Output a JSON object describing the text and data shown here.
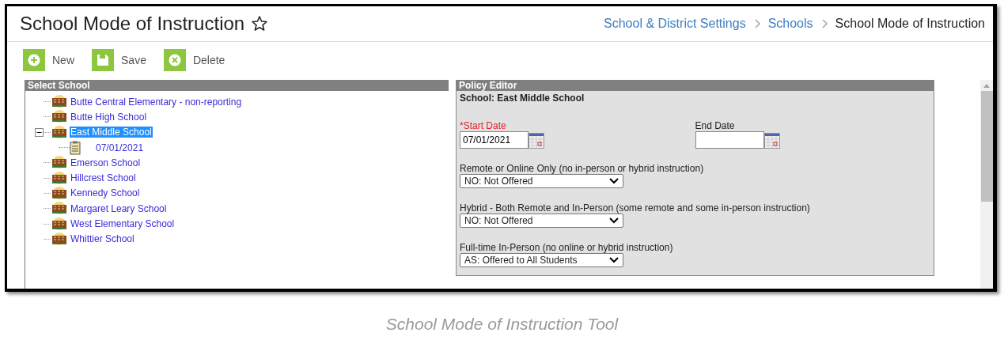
{
  "header": {
    "title": "School Mode of Instruction",
    "favorited": false
  },
  "breadcrumbs": [
    {
      "label": "School & District Settings",
      "link": true
    },
    {
      "label": "Schools",
      "link": true
    },
    {
      "label": "School Mode of Instruction",
      "link": false
    }
  ],
  "toolbar": [
    {
      "label": "New",
      "kind": "new"
    },
    {
      "label": "Save",
      "kind": "save"
    },
    {
      "label": "Delete",
      "kind": "delete"
    }
  ],
  "tree": {
    "title": "Select School",
    "items": [
      {
        "label": "Butte Central Elementary - non-reporting",
        "selected": false,
        "expanded": false
      },
      {
        "label": "Butte High School",
        "selected": false,
        "expanded": false
      },
      {
        "label": "East Middle School",
        "selected": true,
        "expanded": true,
        "children": [
          {
            "label": "07/01/2021",
            "selected": false
          }
        ]
      },
      {
        "label": "Emerson School",
        "selected": false,
        "expanded": false
      },
      {
        "label": "Hillcrest School",
        "selected": false,
        "expanded": false
      },
      {
        "label": "Kennedy School",
        "selected": false,
        "expanded": false
      },
      {
        "label": "Margaret Leary School",
        "selected": false,
        "expanded": false
      },
      {
        "label": "West Elementary School",
        "selected": false,
        "expanded": false
      },
      {
        "label": "Whittier School",
        "selected": false,
        "expanded": false
      }
    ]
  },
  "editor": {
    "title": "Policy Editor",
    "school": "School: East Middle School",
    "dates": [
      {
        "label": "*Start Date",
        "required": true,
        "value": "07/01/2021"
      },
      {
        "label": "End Date",
        "required": false
      }
    ],
    "selects": [
      {
        "label": "Remote or Online Only (no in-person or hybrid instruction)",
        "value": "NO: Not Offered"
      },
      {
        "label": "Hybrid - Both Remote and In-Person (some remote and some in-person instruction)",
        "value": "NO: Not Offered"
      },
      {
        "label": "Full-time In-Person (no online or hybrid instruction)",
        "value": "AS: Offered to All Students"
      }
    ]
  },
  "caption": "School Mode of Instruction Tool"
}
